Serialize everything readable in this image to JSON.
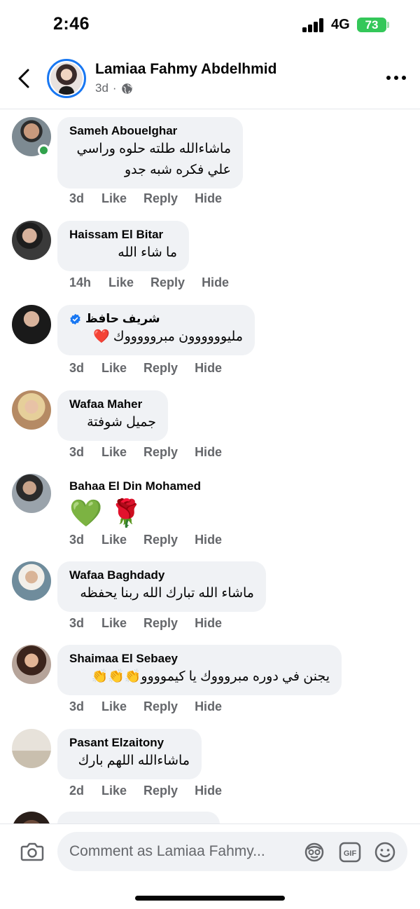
{
  "status_bar": {
    "time": "2:46",
    "network": "4G",
    "battery": "73"
  },
  "header": {
    "name": "Lamiaa Fahmy Abdelhmid",
    "time": "3d",
    "separator": "·"
  },
  "comments": [
    {
      "name": "Sameh Abouelghar",
      "text_lines": [
        "ماشاءالله طلته حلوه وراسي",
        "علي فكره شبه جدو"
      ],
      "time": "3d",
      "online": true
    },
    {
      "name": "Haissam El Bitar",
      "text_lines": [
        "ما شاء الله"
      ],
      "time": "14h"
    },
    {
      "name": "شريف حافظ",
      "text_lines": [
        "مليوووووون مبروووووك ❤️"
      ],
      "time": "3d",
      "verified": true
    },
    {
      "name": "Wafaa Maher",
      "text_lines": [
        "جميل شوفتة"
      ],
      "time": "3d"
    },
    {
      "name": "Bahaa El Din Mohamed",
      "text_lines": [
        "💚 🌹"
      ],
      "time": "3d"
    },
    {
      "name": "Wafaa Baghdady",
      "text_lines": [
        "ماشاء الله تبارك الله ربنا يحفظه"
      ],
      "time": "3d"
    },
    {
      "name": "Shaimaa El Sebaey",
      "text_lines": [
        "يجنن في دوره مبروووك يا كيموووو👏👏👏"
      ],
      "time": "3d"
    },
    {
      "name": "Pasant Elzaitony",
      "text_lines": [
        "ماشاءالله اللهم بارك"
      ],
      "time": "2d"
    }
  ],
  "actions": {
    "like": "Like",
    "reply": "Reply",
    "hide": "Hide"
  },
  "input": {
    "placeholder": "Comment as Lamiaa Fahmy..."
  },
  "colors": {
    "accent": "#1877f2",
    "bubble": "#f0f2f5",
    "meta": "#65676b",
    "online": "#31a24c",
    "battery": "#34c759"
  },
  "icons": [
    "back-chevron-icon",
    "globe-icon",
    "more-icon",
    "verified-icon",
    "camera-icon",
    "avatar-sticker-icon",
    "gif-icon",
    "emoji-icon"
  ]
}
